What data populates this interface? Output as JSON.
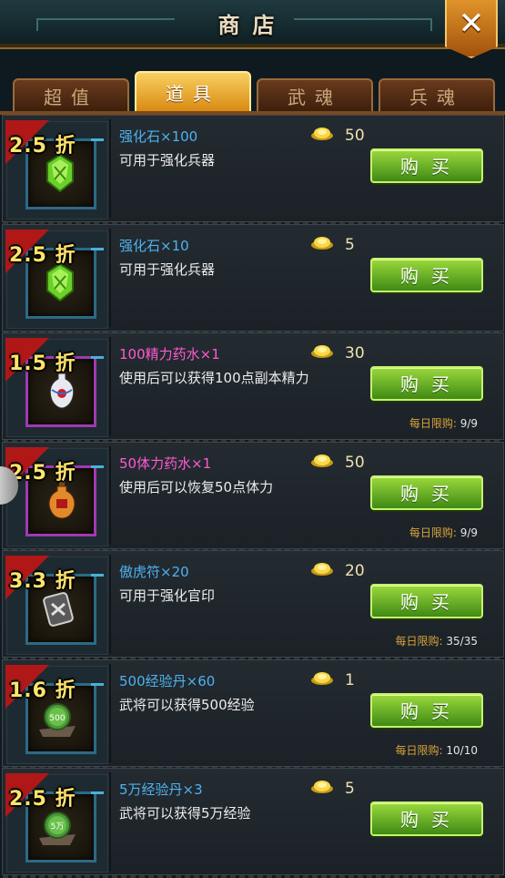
{
  "header": {
    "title": "商店"
  },
  "tabs": [
    {
      "label": "超值"
    },
    {
      "label": "道具",
      "active": true
    },
    {
      "label": "武魂"
    },
    {
      "label": "兵魂"
    }
  ],
  "items": [
    {
      "discount": "2.5 折",
      "name": "强化石×100",
      "desc": "可用于强化兵器",
      "price": "50",
      "buy": "购买",
      "limit_label": "",
      "limit_value": "",
      "icon": "green-gem-icon",
      "frame": "blue",
      "name_color": "blue"
    },
    {
      "discount": "2.5 折",
      "name": "强化石×10",
      "desc": "可用于强化兵器",
      "price": "5",
      "buy": "购买",
      "limit_label": "",
      "limit_value": "",
      "icon": "green-gem-icon",
      "frame": "blue",
      "name_color": "blue"
    },
    {
      "discount": "1.5 折",
      "name": "100精力药水×1",
      "desc": "使用后可以获得100点副本精力",
      "price": "30",
      "buy": "购买",
      "limit_label": "每日限购:",
      "limit_value": "9/9",
      "icon": "potion-vase-icon",
      "frame": "purple",
      "name_color": "pink"
    },
    {
      "discount": "2.5 折",
      "name": "50体力药水×1",
      "desc": "使用后可以恢复50点体力",
      "price": "50",
      "buy": "购买",
      "limit_label": "每日限购:",
      "limit_value": "9/9",
      "icon": "gourd-icon",
      "frame": "purple",
      "name_color": "pink"
    },
    {
      "discount": "3.3 折",
      "name": "傲虎符×20",
      "desc": "可用于强化官印",
      "price": "20",
      "buy": "购买",
      "limit_label": "每日限购:",
      "limit_value": "35/35",
      "icon": "tiger-seal-icon",
      "frame": "blue",
      "name_color": "blue"
    },
    {
      "discount": "1.6 折",
      "name": "500经验丹×60",
      "desc": "武将可以获得500经验",
      "price": "1",
      "buy": "购买",
      "limit_label": "每日限购:",
      "limit_value": "10/10",
      "icon": "exp-pill-icon",
      "frame": "blue",
      "name_color": "blue",
      "pill_text": "500"
    },
    {
      "discount": "2.5 折",
      "name": "5万经验丹×3",
      "desc": "武将可以获得5万经验",
      "price": "5",
      "buy": "购买",
      "limit_label": "",
      "limit_value": "",
      "icon": "exp-pill-icon",
      "frame": "blue",
      "name_color": "blue",
      "pill_text": "5万"
    }
  ],
  "colors": {
    "accent_gold": "#f8d060",
    "buy_green": "#6ab828",
    "discount_red": "#b01818"
  }
}
